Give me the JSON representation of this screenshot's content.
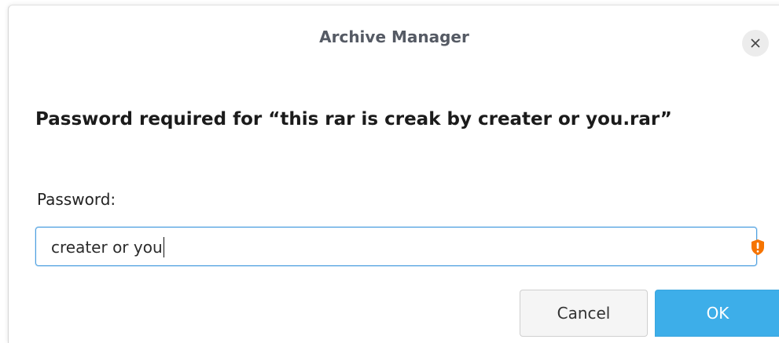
{
  "window": {
    "title": "Archive Manager",
    "close_icon": "close-icon"
  },
  "dialog": {
    "heading": "Password required for “this rar is creak by creater or you.rar”",
    "password_label": "Password:",
    "password_value": "creater or you",
    "warning_icon": "caps-lock-warning-icon",
    "warning_color": "#f67400"
  },
  "buttons": {
    "cancel_label": "Cancel",
    "ok_label": "OK"
  },
  "colors": {
    "accent": "#3daee9",
    "focus_border": "#4d9fe0"
  }
}
